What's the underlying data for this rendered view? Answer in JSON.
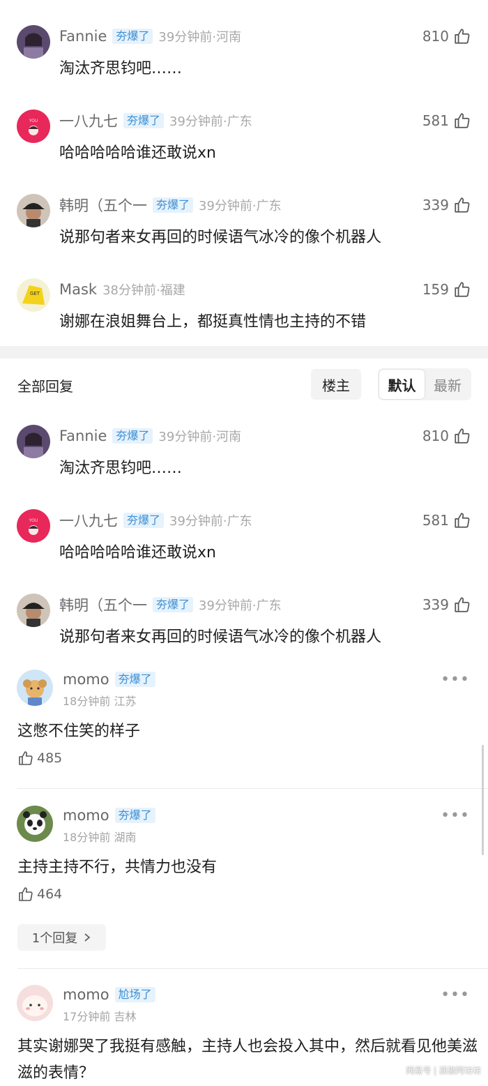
{
  "top_comments": [
    {
      "name": "Fannie",
      "badge": "夯爆了",
      "time": "39分钟前·河南",
      "likes": "810",
      "text": "淘汰齐思钧吧……"
    },
    {
      "name": "一八九七",
      "badge": "夯爆了",
      "time": "39分钟前·广东",
      "likes": "581",
      "text": "哈哈哈哈哈谁还敢说xn"
    },
    {
      "name": "韩明（五个一",
      "badge": "夯爆了",
      "time": "39分钟前·广东",
      "likes": "339",
      "text": "说那句者来女再回的时候语气冰冷的像个机器人"
    },
    {
      "name": "Mask",
      "badge": "",
      "time": "38分钟前·福建",
      "likes": "159",
      "text": "谢娜在浪姐舞台上，都挺真性情也主持的不错"
    }
  ],
  "tabs": {
    "title": "全部回复",
    "louzhu": "楼主",
    "default": "默认",
    "latest": "最新"
  },
  "list_comments": [
    {
      "name": "Fannie",
      "badge": "夯爆了",
      "time": "39分钟前·河南",
      "likes": "810",
      "text": "淘汰齐思钧吧……"
    },
    {
      "name": "一八九七",
      "badge": "夯爆了",
      "time": "39分钟前·广东",
      "likes": "581",
      "text": "哈哈哈哈哈谁还敢说xn"
    },
    {
      "name": "韩明（五个一",
      "badge": "夯爆了",
      "time": "39分钟前·广东",
      "likes": "339",
      "text": "说那句者来女再回的时候语气冰冷的像个机器人"
    }
  ],
  "replies": [
    {
      "name": "momo",
      "badge": "夯爆了",
      "sub": "18分钟前 江苏",
      "text": "这憋不住笑的样子",
      "likes": "485"
    },
    {
      "name": "momo",
      "badge": "夯爆了",
      "sub": "18分钟前 湖南",
      "text": "主持主持不行，共情力也没有",
      "likes": "464",
      "reply_count": "1个回复"
    },
    {
      "name": "momo",
      "badge": "尬场了",
      "sub": "17分钟前 吉林",
      "text": "其实谢娜哭了我挺有感触，主持人也会投入其中，然后就看见他美滋滋的表情？"
    }
  ],
  "more_label": "•••",
  "watermark": "网易号 | 孤傲阿坊坊",
  "colors": {
    "badge_text": "#3b8fd4",
    "badge_bg": "#e6f2fc",
    "divider": "#f2f2f2"
  }
}
